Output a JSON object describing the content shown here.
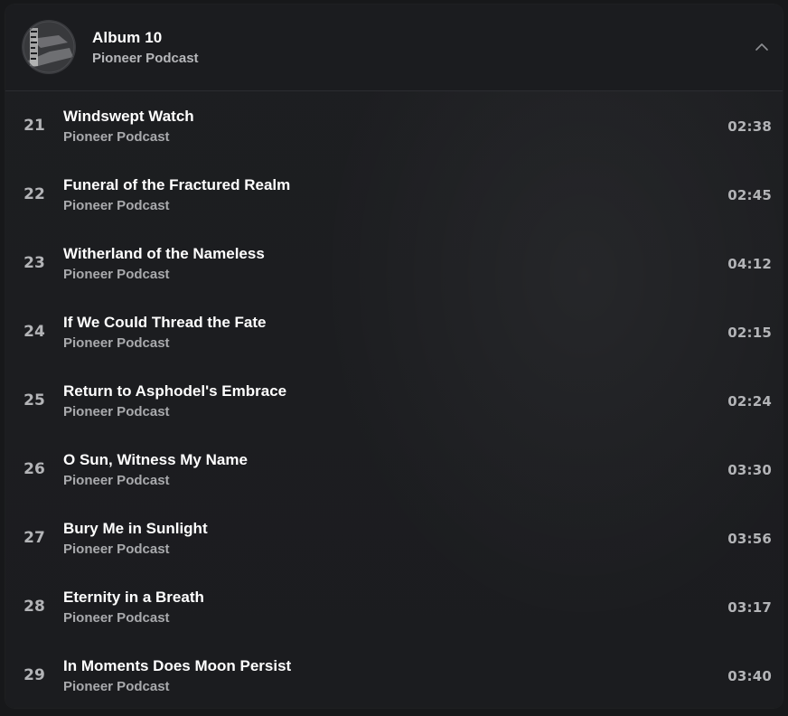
{
  "album": {
    "title": "Album 10",
    "artist": "Pioneer Podcast",
    "cover_icon": "album-cover-art",
    "collapse_icon": "chevron-up-icon"
  },
  "tracks": [
    {
      "number": "21",
      "title": "Windswept Watch",
      "artist": "Pioneer Podcast",
      "duration": "02:38"
    },
    {
      "number": "22",
      "title": "Funeral of the Fractured Realm",
      "artist": "Pioneer Podcast",
      "duration": "02:45"
    },
    {
      "number": "23",
      "title": "Witherland of the Nameless",
      "artist": "Pioneer Podcast",
      "duration": "04:12"
    },
    {
      "number": "24",
      "title": "If We Could Thread the Fate",
      "artist": "Pioneer Podcast",
      "duration": "02:15"
    },
    {
      "number": "25",
      "title": "Return to Asphodel's Embrace",
      "artist": "Pioneer Podcast",
      "duration": "02:24"
    },
    {
      "number": "26",
      "title": "O Sun, Witness My Name",
      "artist": "Pioneer Podcast",
      "duration": "03:30"
    },
    {
      "number": "27",
      "title": "Bury Me in Sunlight",
      "artist": "Pioneer Podcast",
      "duration": "03:56"
    },
    {
      "number": "28",
      "title": "Eternity in a Breath",
      "artist": "Pioneer Podcast",
      "duration": "03:17"
    },
    {
      "number": "29",
      "title": "In Moments Does Moon Persist",
      "artist": "Pioneer Podcast",
      "duration": "03:40"
    }
  ],
  "colors": {
    "background": "#17181a",
    "panel": "#1c1d20",
    "text_primary": "#ffffff",
    "text_secondary": "#a9aaad"
  }
}
